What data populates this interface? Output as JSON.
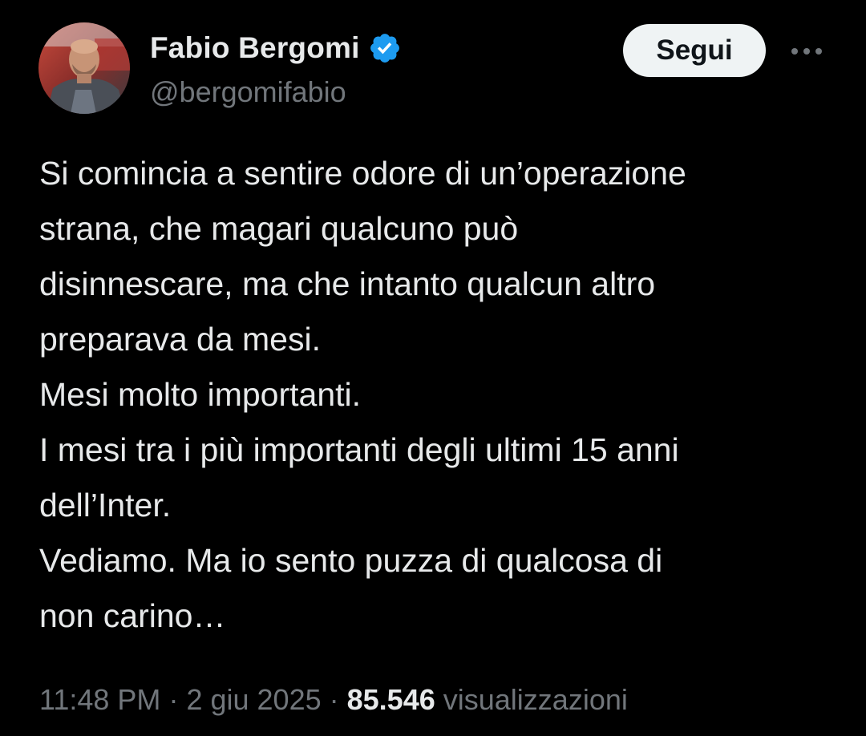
{
  "author": {
    "display_name": "Fabio Bergomi",
    "handle": "@bergomifabio",
    "verified": true,
    "verified_icon": "verified-badge-icon",
    "avatar_icon": "avatar"
  },
  "actions": {
    "follow_label": "Segui",
    "more_icon": "more-options-icon"
  },
  "tweet": {
    "lines": [
      "Si comincia a sentire odore di un’operazione",
      "strana, che magari qualcuno può",
      "disinnescare, ma che intanto qualcun altro",
      "preparava da mesi.",
      "Mesi molto importanti.",
      "I mesi tra i più importanti degli ultimi 15 anni",
      "dell’Inter.",
      "Vediamo. Ma io sento puzza di qualcosa di",
      "non carino…"
    ]
  },
  "meta": {
    "time": "11:48 PM",
    "separator": "·",
    "date": "2 giu 2025",
    "views_count": "85.546",
    "views_label": "visualizzazioni"
  },
  "colors": {
    "background": "#000000",
    "text_primary": "#e7e9ea",
    "text_secondary": "#71767b",
    "verified_blue": "#1d9bf0",
    "button_bg": "#eff3f4",
    "button_text": "#0f1419"
  }
}
